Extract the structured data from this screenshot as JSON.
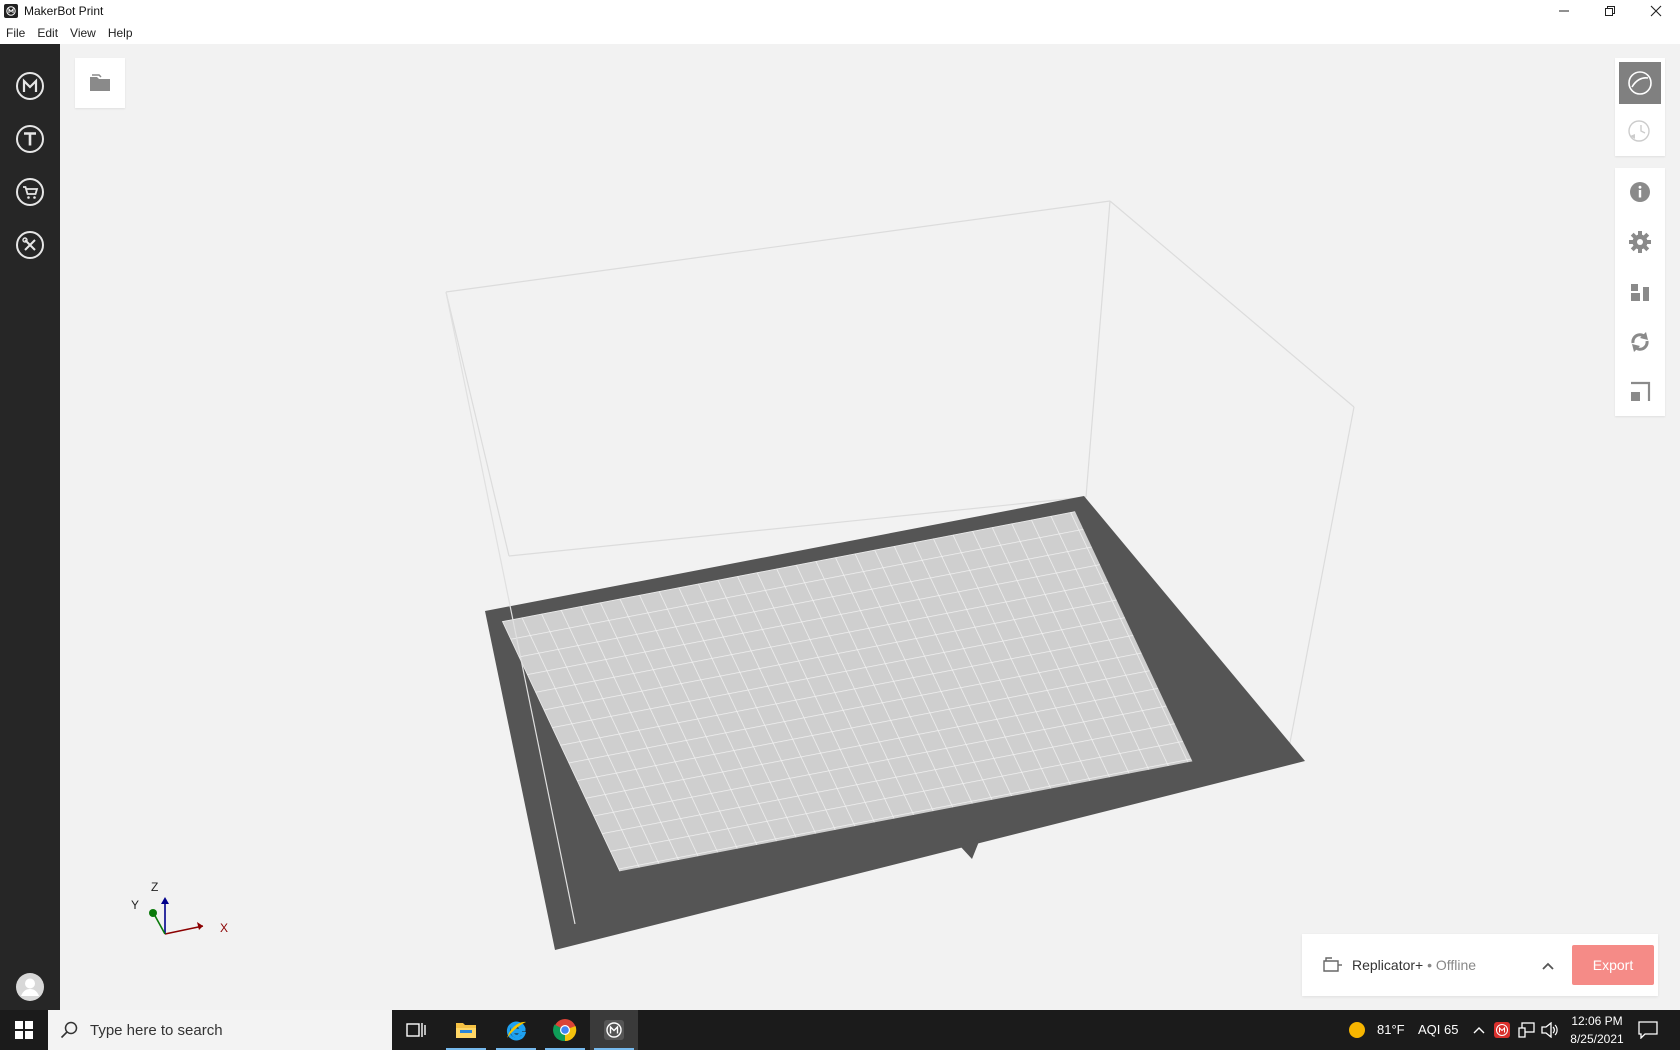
{
  "window": {
    "title": "MakerBot Print"
  },
  "menu": {
    "items": [
      "File",
      "Edit",
      "View",
      "Help"
    ]
  },
  "sidebar": {
    "icons": [
      "makerbot-logo-icon",
      "thingiverse-icon",
      "store-cart-icon",
      "tools-icon"
    ],
    "account_icon": "user-avatar-icon"
  },
  "toolbar_right": {
    "view_modes": [
      "prepare-view-icon",
      "preview-view-icon"
    ],
    "tools": [
      "info-icon",
      "settings-gear-icon",
      "arrange-icon",
      "orient-icon",
      "scale-icon"
    ]
  },
  "axes": {
    "x": "X",
    "y": "Y",
    "z": "Z"
  },
  "printer": {
    "name": "Replicator+",
    "status": " • Offline",
    "export_label": "Export",
    "accent": "#f58b87"
  },
  "taskbar": {
    "search_placeholder": "Type here to search",
    "weather_temp": "81°F",
    "aqi": "AQI 65",
    "time": "12:06 PM",
    "date": "8/25/2021"
  }
}
